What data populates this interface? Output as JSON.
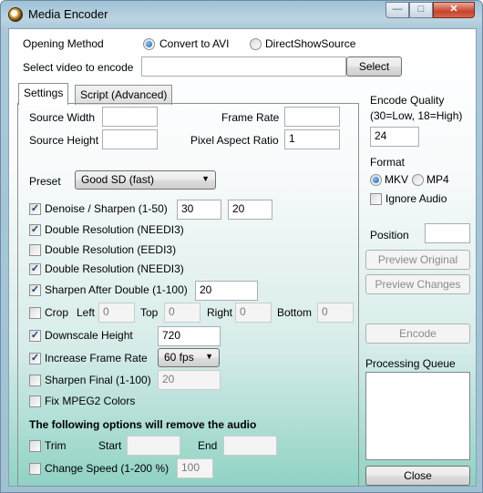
{
  "window": {
    "title": "Media Encoder",
    "minimize_glyph": "—",
    "maximize_glyph": "□",
    "close_glyph": "✕"
  },
  "opening": {
    "label": "Opening Method",
    "option_avi": "Convert to AVI",
    "option_dshow": "DirectShowSource",
    "selected": "Convert to AVI",
    "select_video_label": "Select video to encode",
    "video_path": "",
    "select_button": "Select"
  },
  "tabs": [
    {
      "label": "Settings",
      "active": true
    },
    {
      "label": "Script (Advanced)",
      "active": false
    }
  ],
  "settings": {
    "source_width_label": "Source Width",
    "source_width": "",
    "source_height_label": "Source Height",
    "source_height": "",
    "frame_rate_label": "Frame Rate",
    "frame_rate": "",
    "par_label": "Pixel Aspect Ratio",
    "par": "1",
    "preset_label": "Preset",
    "preset": "Good SD (fast)",
    "denoise_label": "Denoise / Sharpen (1-50)",
    "denoise_checked": true,
    "denoise_value": "30",
    "sharpen_value": "20",
    "double_nnedi_1_label": "Double Resolution (NEEDI3)",
    "double_nnedi_1_checked": true,
    "double_eedi_label": "Double Resolution (EEDI3)",
    "double_eedi_checked": false,
    "double_nnedi_2_label": "Double Resolution (NEEDI3)",
    "double_nnedi_2_checked": true,
    "sharpen_after_label": "Sharpen After Double (1-100)",
    "sharpen_after_checked": true,
    "sharpen_after_value": "20",
    "crop_label": "Crop",
    "crop_checked": false,
    "crop_left_label": "Left",
    "crop_left": "0",
    "crop_top_label": "Top",
    "crop_top": "0",
    "crop_right_label": "Right",
    "crop_right": "0",
    "crop_bottom_label": "Bottom",
    "crop_bottom": "0",
    "downscale_label": "Downscale Height",
    "downscale_checked": true,
    "downscale_value": "720",
    "increase_fps_label": "Increase Frame Rate",
    "increase_fps_checked": true,
    "increase_fps_value": "60 fps",
    "sharpen_final_label": "Sharpen Final (1-100)",
    "sharpen_final_checked": false,
    "sharpen_final_value": "20",
    "fix_mpeg2_label": "Fix MPEG2 Colors",
    "fix_mpeg2_checked": false,
    "audio_warning": "The following options will remove the audio",
    "trim_label": "Trim",
    "trim_checked": false,
    "trim_start_label": "Start",
    "trim_start": "",
    "trim_end_label": "End",
    "trim_end": "",
    "change_speed_label": "Change Speed (1-200 %)",
    "change_speed_checked": false,
    "change_speed_value": "100"
  },
  "side": {
    "encode_quality_label": "Encode Quality",
    "encode_quality_hint": "(30=Low, 18=High)",
    "encode_quality": "24",
    "format_label": "Format",
    "format_mkv": "MKV",
    "format_mp4": "MP4",
    "format_selected": "MKV",
    "ignore_audio_label": "Ignore Audio",
    "ignore_audio_checked": false,
    "position_label": "Position",
    "position_value": "",
    "preview_original": "Preview Original",
    "preview_changes": "Preview Changes",
    "encode": "Encode",
    "queue_label": "Processing Queue",
    "close": "Close"
  }
}
